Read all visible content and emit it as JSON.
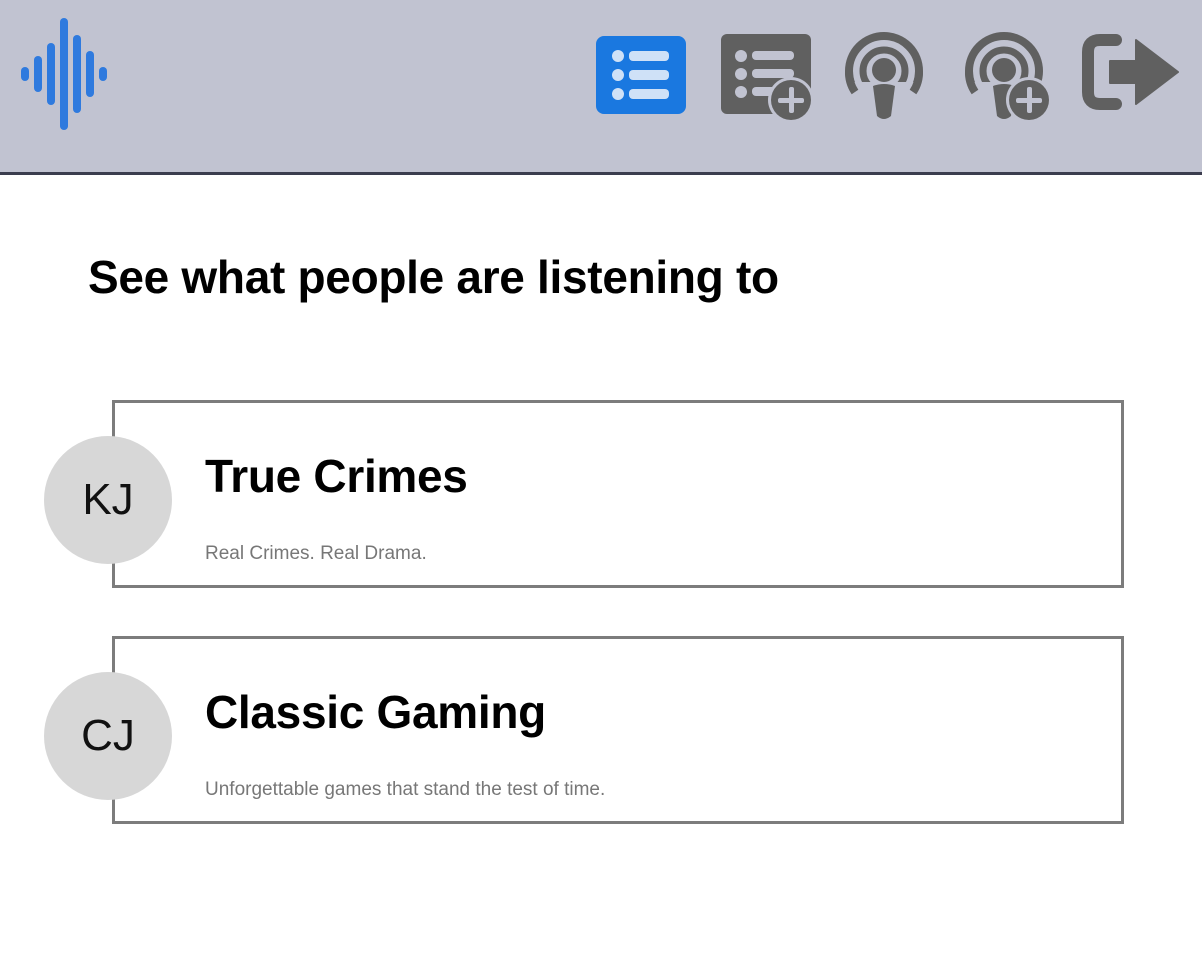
{
  "app": {
    "logo_icon": "soundwave-logo-icon",
    "accent_color": "#1a78e0",
    "header_color": "#c1c3d1",
    "icon_color": "#606060"
  },
  "nav": [
    {
      "icon": "list-icon",
      "active": true
    },
    {
      "icon": "add-list-icon",
      "active": false
    },
    {
      "icon": "podcast-icon",
      "active": false
    },
    {
      "icon": "add-podcast-icon",
      "active": false
    },
    {
      "icon": "logout-icon",
      "active": false
    }
  ],
  "main": {
    "title": "See what people are listening to",
    "items": [
      {
        "avatar_initials": "KJ",
        "title": "True Crimes",
        "description": "Real Crimes. Real Drama."
      },
      {
        "avatar_initials": "CJ",
        "title": "Classic Gaming",
        "description": "Unforgettable games that stand the test of time."
      }
    ]
  }
}
